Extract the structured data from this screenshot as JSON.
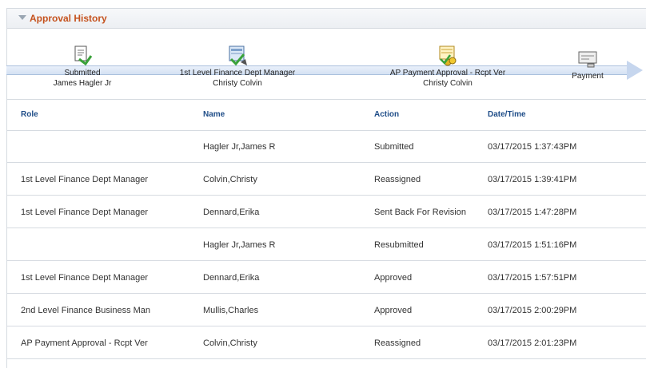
{
  "section": {
    "title": "Approval History"
  },
  "stages": [
    {
      "line1": "Submitted",
      "line2": "James Hagler Jr",
      "icon": "submit-icon"
    },
    {
      "line1": "1st Level Finance Dept Manager",
      "line2": "Christy Colvin",
      "icon": "approval-doc-icon"
    },
    {
      "line1": "AP Payment Approval - Rcpt Ver",
      "line2": "Christy Colvin",
      "icon": "coins-icon"
    },
    {
      "line1": "Payment",
      "line2": "",
      "icon": "payment-icon"
    }
  ],
  "table": {
    "headers": {
      "role": "Role",
      "name": "Name",
      "action": "Action",
      "datetime": "Date/Time"
    },
    "rows": [
      {
        "role": "",
        "name": "Hagler Jr,James R",
        "action": "Submitted",
        "datetime": "03/17/2015  1:37:43PM"
      },
      {
        "role": "1st Level Finance Dept Manager",
        "name": "Colvin,Christy",
        "action": "Reassigned",
        "datetime": "03/17/2015  1:39:41PM"
      },
      {
        "role": "1st Level Finance Dept Manager",
        "name": "Dennard,Erika",
        "action": "Sent Back For Revision",
        "datetime": "03/17/2015  1:47:28PM"
      },
      {
        "role": "",
        "name": "Hagler Jr,James R",
        "action": "Resubmitted",
        "datetime": "03/17/2015  1:51:16PM"
      },
      {
        "role": "1st Level Finance Dept Manager",
        "name": "Dennard,Erika",
        "action": "Approved",
        "datetime": "03/17/2015  1:57:51PM"
      },
      {
        "role": "2nd Level Finance Business Man",
        "name": "Mullis,Charles",
        "action": "Approved",
        "datetime": "03/17/2015  2:00:29PM"
      },
      {
        "role": "AP Payment Approval - Rcpt Ver",
        "name": "Colvin,Christy",
        "action": "Reassigned",
        "datetime": "03/17/2015  2:01:23PM"
      }
    ]
  },
  "colors": {
    "title": "#c5521e",
    "header_text": "#1f4d88",
    "border": "#d6dbe1"
  }
}
